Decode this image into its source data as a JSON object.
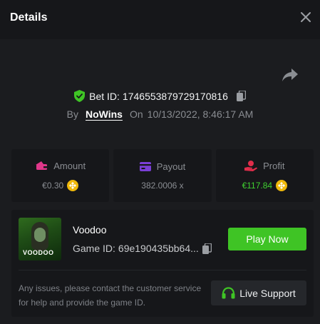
{
  "header": {
    "title": "Details"
  },
  "bet": {
    "id_label": "Bet ID:",
    "id_value": "1746553879729170816",
    "by_label": "By",
    "user": "NoWins",
    "on_label": "On",
    "datetime": "10/13/2022, 8:46:17 AM"
  },
  "stats": [
    {
      "label": "Amount",
      "value": "€0.30"
    },
    {
      "label": "Payout",
      "value": "382.0006 x"
    },
    {
      "label": "Profit",
      "value": "€117.84"
    }
  ],
  "game": {
    "thumb_text": "VOODOO",
    "name": "Voodoo",
    "id_label": "Game ID:",
    "id_value": "69e190435bb64...",
    "play_label": "Play Now",
    "help_text": "Any issues, please contact the customer service for help and provide the game ID.",
    "support_label": "Live Support"
  },
  "colors": {
    "accent_green": "#3fc425",
    "profit_green": "#3fd130",
    "coin_gold": "#f0b90b",
    "amount_pink": "#e0378a",
    "payout_purple": "#7a3fd6",
    "profit_red": "#e02d4a"
  },
  "icons": {
    "close": "close-icon",
    "share": "share-icon",
    "verified": "shield-check-icon",
    "copy": "copy-icon",
    "amount": "wallet-icon",
    "payout": "card-icon",
    "profit": "hand-coin-icon",
    "coin": "coin-icon",
    "support": "headset-icon"
  }
}
